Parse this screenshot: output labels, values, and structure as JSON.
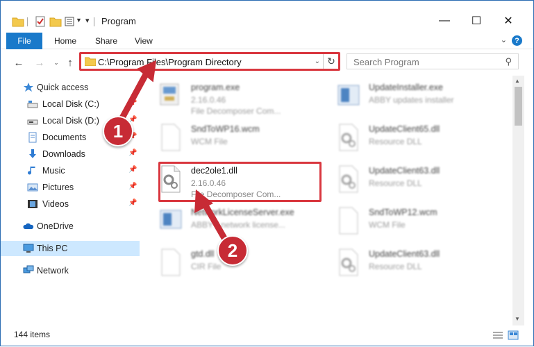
{
  "window": {
    "title": "Program",
    "controls": {
      "minimize": "—",
      "maximize": "☐",
      "close": "✕"
    }
  },
  "ribbon": {
    "tabs": [
      "File",
      "Home",
      "Share",
      "View"
    ],
    "help": "?"
  },
  "address": {
    "path": "C:\\Program Files\\Program Directory",
    "search_placeholder": "Search Program"
  },
  "sidebar": {
    "items": [
      {
        "label": "Quick access",
        "icon": "star-icon",
        "pinned": false
      },
      {
        "label": "Local Disk (C:)",
        "icon": "drive-icon",
        "pinned": true
      },
      {
        "label": "Local Disk (D:)",
        "icon": "drive-icon",
        "pinned": true
      },
      {
        "label": "Documents",
        "icon": "documents-icon",
        "pinned": true
      },
      {
        "label": "Downloads",
        "icon": "downloads-icon",
        "pinned": true
      },
      {
        "label": "Music",
        "icon": "music-icon",
        "pinned": true
      },
      {
        "label": "Pictures",
        "icon": "pictures-icon",
        "pinned": true
      },
      {
        "label": "Videos",
        "icon": "videos-icon",
        "pinned": true
      },
      {
        "label": "OneDrive",
        "icon": "onedrive-icon",
        "pinned": false
      },
      {
        "label": "This PC",
        "icon": "this-pc-icon",
        "pinned": false,
        "selected": true
      },
      {
        "label": "Network",
        "icon": "network-icon",
        "pinned": false
      }
    ]
  },
  "files": [
    {
      "name": "program.exe",
      "line2": "2.16.0.46",
      "line3": "File Decomposer Com...",
      "icon": "exe-icon"
    },
    {
      "name": "UpdateInstaller.exe",
      "line2": "ABBY updates installer",
      "line3": "",
      "icon": "installer-icon"
    },
    {
      "name": "SndToWP16.wcm",
      "line2": "WCM File",
      "line3": "",
      "icon": "blank-file-icon"
    },
    {
      "name": "UpdateClient65.dll",
      "line2": "Resource DLL",
      "line3": "",
      "icon": "dll-icon"
    },
    {
      "name": "dec2ole1.dll",
      "line2": "2.16.0.46",
      "line3": "File Decomposer Com...",
      "icon": "dll-icon"
    },
    {
      "name": "UpdateClient63.dll",
      "line2": "Resource DLL",
      "line3": "",
      "icon": "dll-icon"
    },
    {
      "name": "NetworkLicenseServer.exe",
      "line2": "ABBYY network license...",
      "line3": "",
      "icon": "exe-icon"
    },
    {
      "name": "SndToWP12.wcm",
      "line2": "WCM File",
      "line3": "",
      "icon": "blank-file-icon"
    },
    {
      "name": "gtd.dll",
      "line2": "CIR File",
      "line3": "",
      "icon": "blank-file-icon"
    },
    {
      "name": "UpdateClient63.dll",
      "line2": "Resource DLL",
      "line3": "",
      "icon": "dll-icon"
    }
  ],
  "status": {
    "count": "144 items"
  },
  "callouts": [
    "1",
    "2"
  ],
  "colors": {
    "accent": "#1979ca",
    "highlight": "#d9363e",
    "selected_bg": "#cde8ff"
  }
}
